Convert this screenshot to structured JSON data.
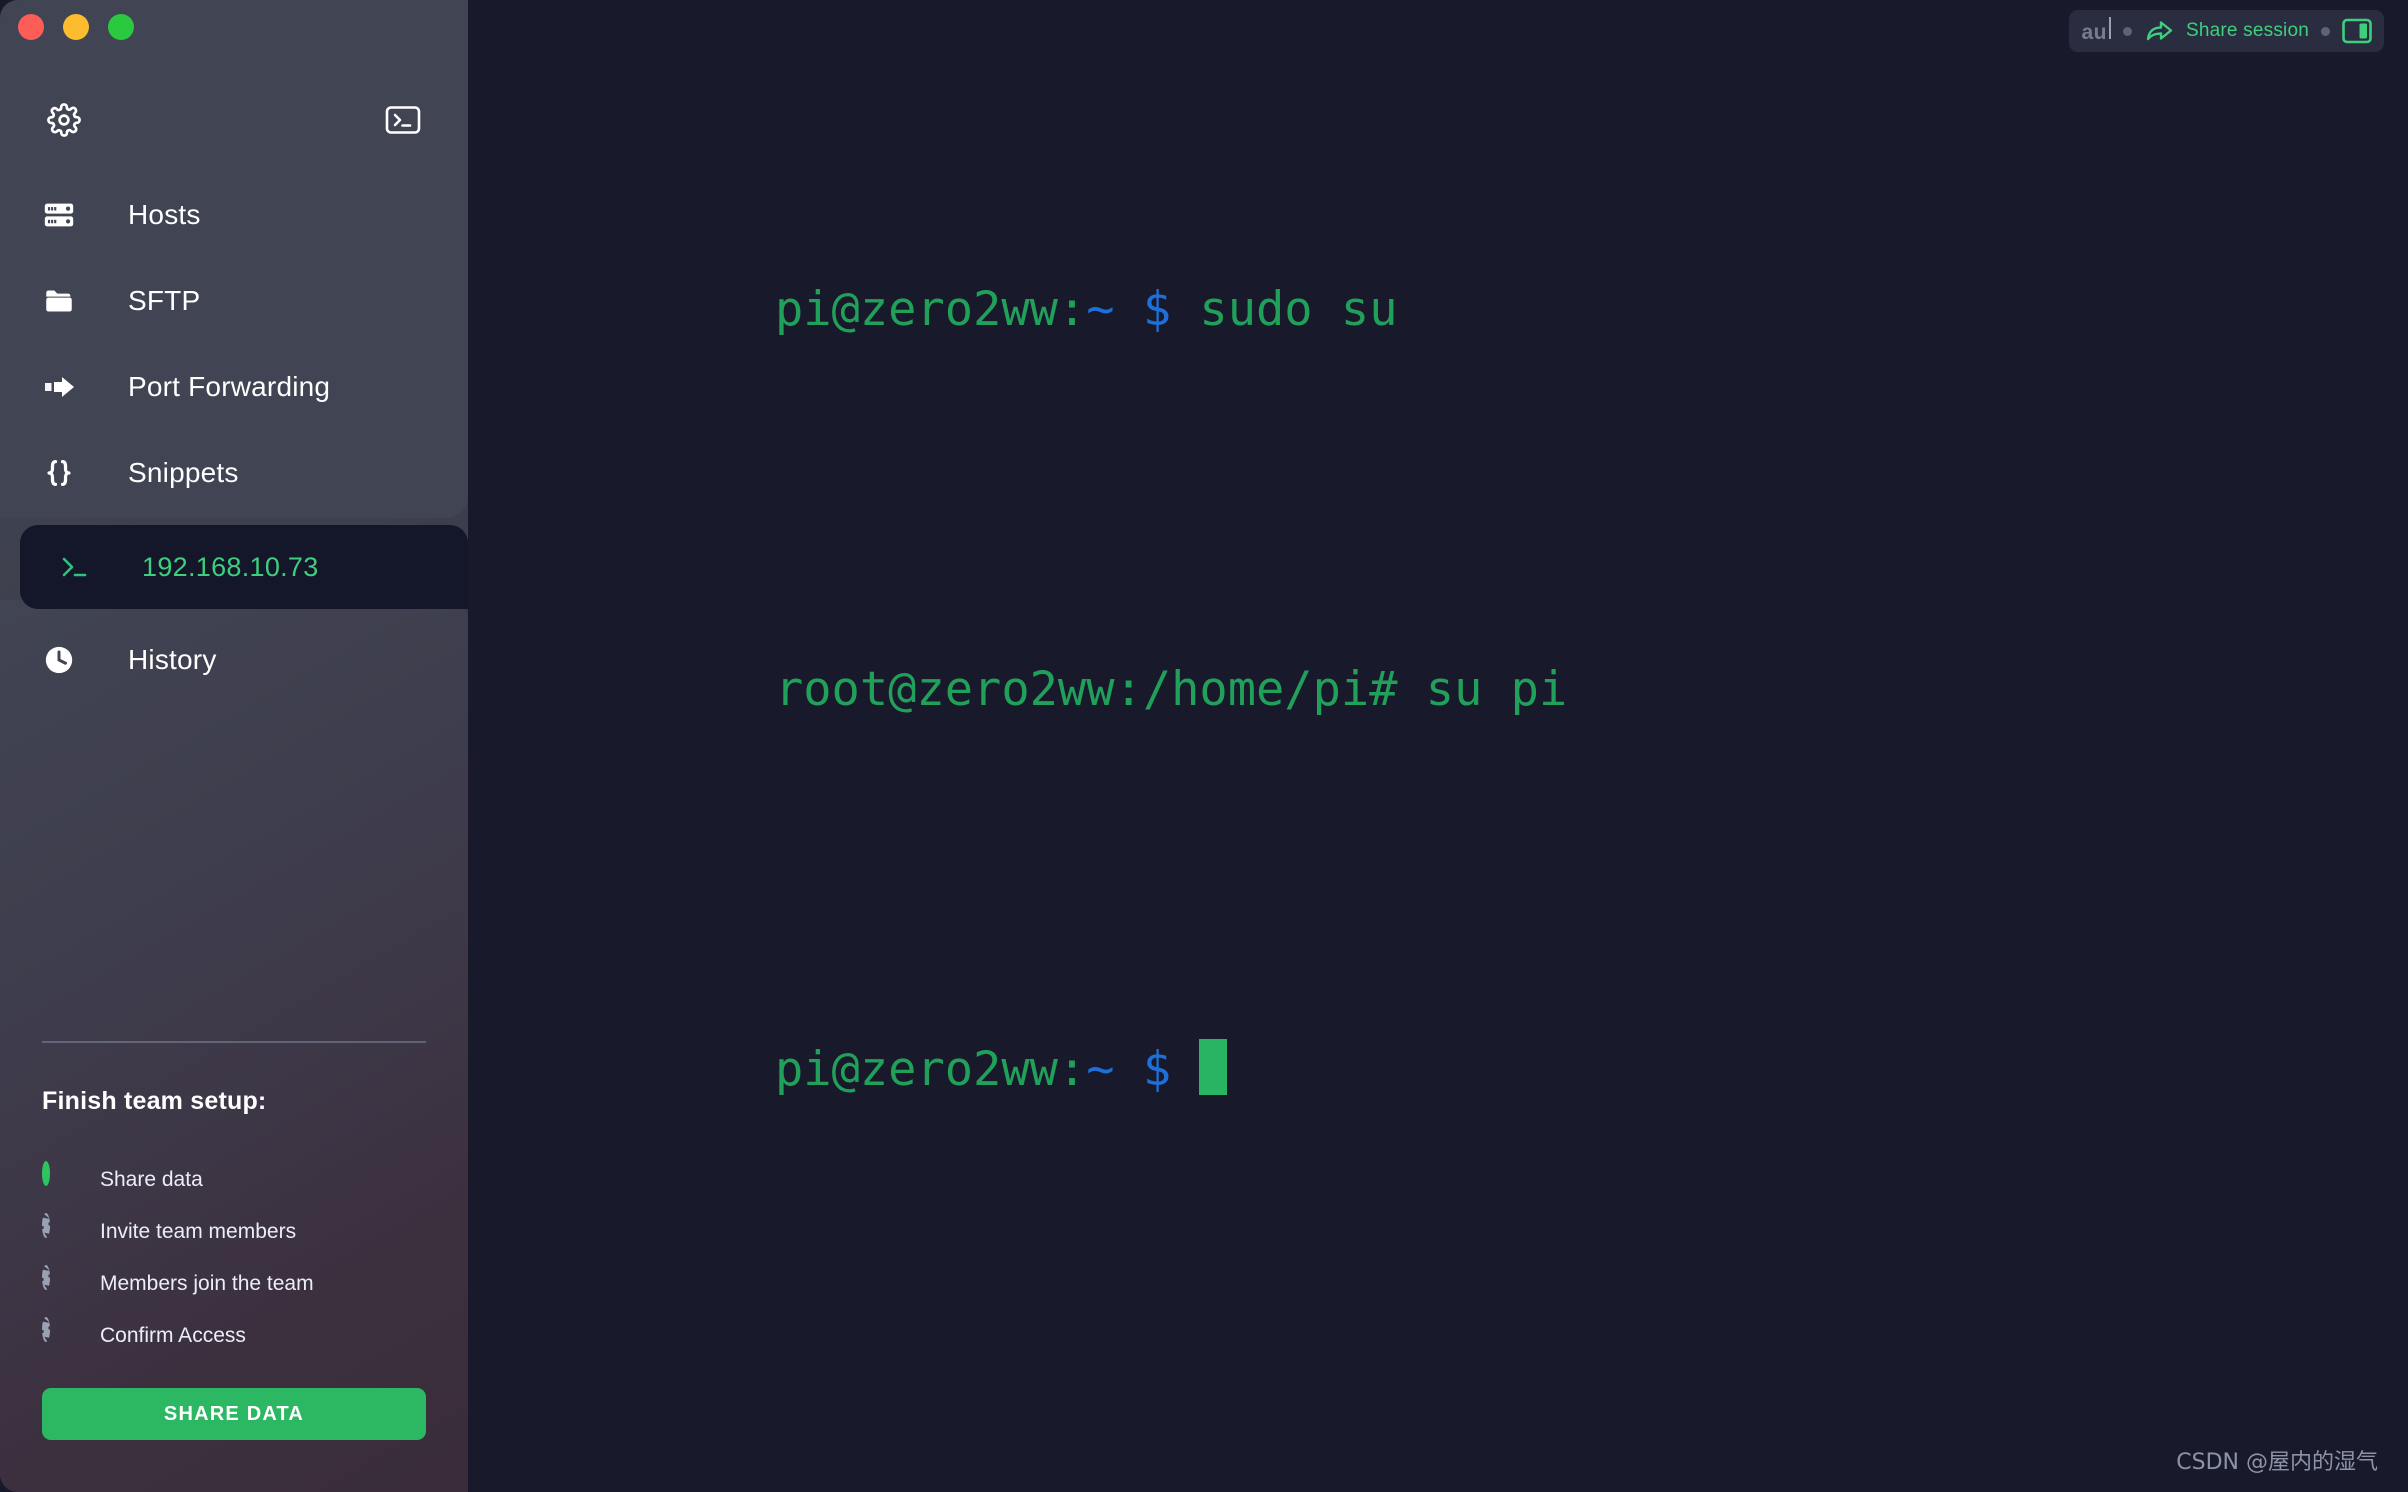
{
  "window": {
    "traffic_lights": [
      {
        "name": "close",
        "color": "#fc5d56"
      },
      {
        "name": "minimize",
        "color": "#fdbc2e"
      },
      {
        "name": "maximize",
        "color": "#2bc93f"
      }
    ]
  },
  "sidebar": {
    "header": {
      "settings_icon": "gear-icon",
      "new_terminal_icon": "terminal-box-icon"
    },
    "nav_items": [
      {
        "icon": "server-icon",
        "label": "Hosts"
      },
      {
        "icon": "folder-icon",
        "label": "SFTP"
      },
      {
        "icon": "arrow-forward-icon",
        "label": "Port Forwarding"
      },
      {
        "icon": "curly-braces-icon",
        "label": "Snippets"
      }
    ],
    "active_session": {
      "icon": "terminal-prompt-icon",
      "label": "192.168.10.73",
      "color": "#3ecf7e"
    },
    "history": {
      "icon": "clock-icon",
      "label": "History"
    },
    "team_setup": {
      "title": "Finish team setup:",
      "steps": [
        {
          "label": "Share data",
          "state": "current"
        },
        {
          "label": "Invite team members",
          "state": "pending"
        },
        {
          "label": "Members join the team",
          "state": "pending"
        },
        {
          "label": "Confirm Access",
          "state": "pending"
        }
      ],
      "button_label": "SHARE DATA",
      "button_color": "#2cb862"
    }
  },
  "toolbar": {
    "user_text": "au",
    "share_icon": "share-arrow-icon",
    "share_label": "Share session",
    "split_icon": "split-pane-icon",
    "accent_color": "#3ecf7e"
  },
  "terminal": {
    "lines": [
      {
        "parts": [
          {
            "text": "pi@zero2ww:",
            "color": "green"
          },
          {
            "text": "~",
            "color": "blue"
          },
          {
            "text": " ",
            "color": "green"
          },
          {
            "text": "$",
            "color": "blue"
          },
          {
            "text": " sudo su",
            "color": "green"
          }
        ]
      },
      {
        "parts": [
          {
            "text": "root@zero2ww:",
            "color": "green"
          },
          {
            "text": "/home/pi# su pi",
            "color": "green"
          }
        ]
      },
      {
        "parts": [
          {
            "text": "pi@zero2ww:",
            "color": "green"
          },
          {
            "text": "~",
            "color": "blue"
          },
          {
            "text": " ",
            "color": "green"
          },
          {
            "text": "$",
            "color": "blue"
          },
          {
            "text": " ",
            "color": "green"
          }
        ],
        "cursor": true
      }
    ],
    "colors": {
      "green": "#21a05a",
      "blue": "#1e6fd9",
      "background": "#181a2c",
      "cursor": "#28b463"
    }
  },
  "watermark": "CSDN @屋内的湿气"
}
